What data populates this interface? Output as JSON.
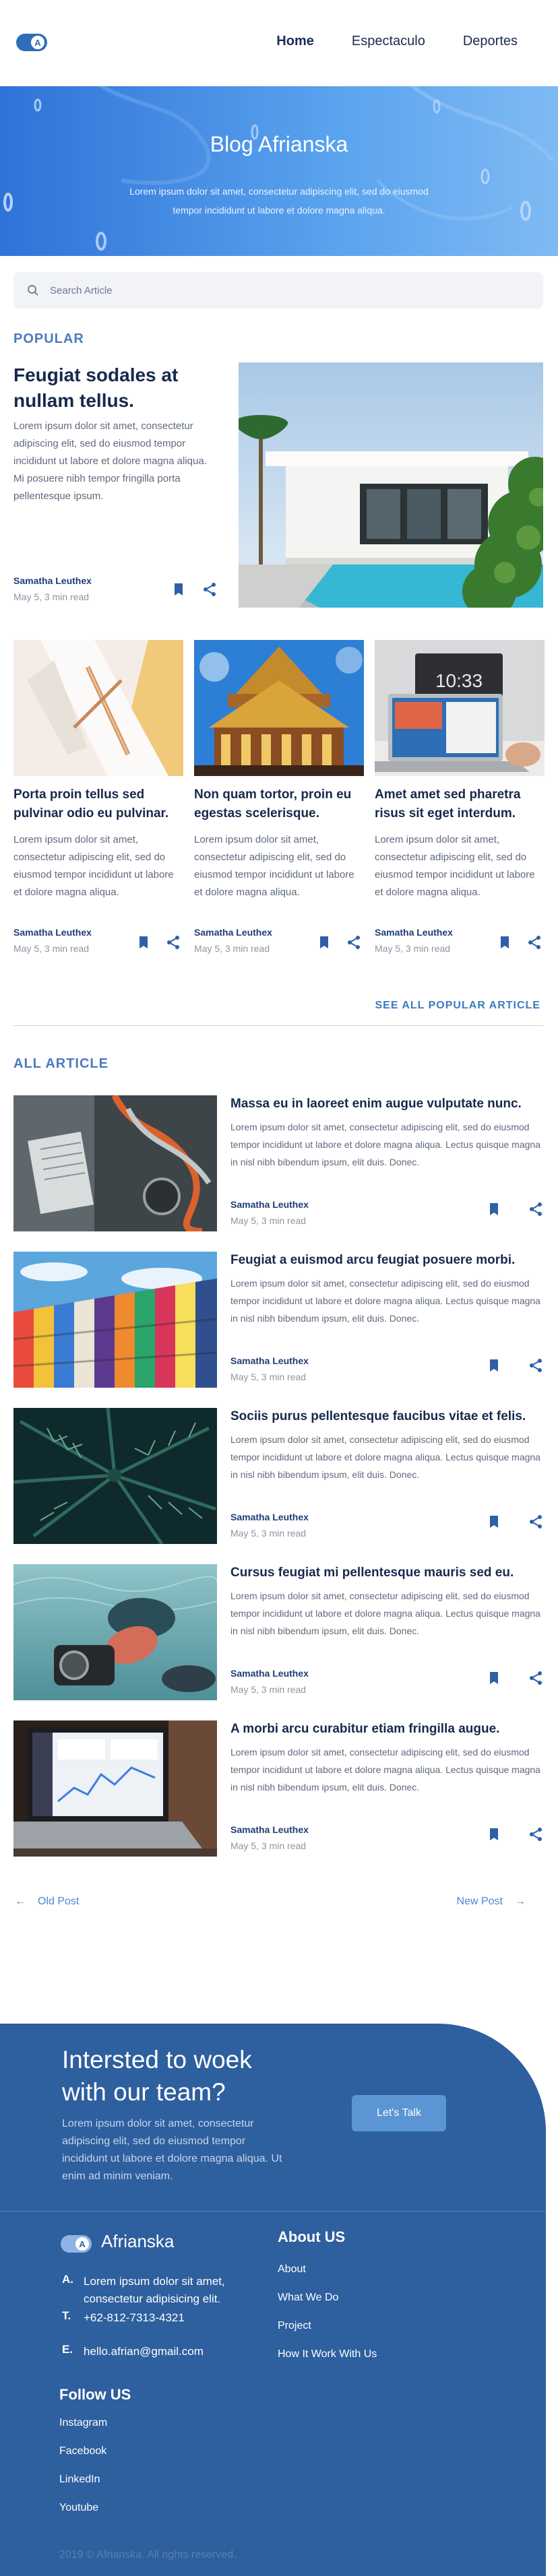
{
  "nav": {
    "items": [
      "Home",
      "Espectaculo",
      "Deportes"
    ],
    "active": "Home"
  },
  "hero": {
    "title": "Blog Afrianska",
    "subtitle": "Lorem ipsum dolor sit amet, consectetur adipiscing elit, sed do eiusmod tempor incididunt ut labore et dolore magna aliqua."
  },
  "search": {
    "placeholder": "Search Article"
  },
  "popular": {
    "heading": "POPULAR",
    "featured": {
      "title": "Feugiat sodales at nullam tellus.",
      "body": "Lorem ipsum dolor sit amet, consectetur adipiscing elit, sed do eiusmod tempor incididunt ut labore et dolore magna aliqua. Mi posuere nibh tempor fringilla porta pellentesque ipsum.",
      "author": "Samatha Leuthex",
      "meta": "May 5, 3 min read"
    },
    "cards": [
      {
        "title": "Porta proin tellus sed pulvinar odio eu pulvinar.",
        "body": "Lorem ipsum dolor sit amet, consectetur adipiscing elit, sed do eiusmod tempor incididunt ut labore et dolore magna aliqua.",
        "author": "Samatha Leuthex",
        "meta": "May 5, 3 min read"
      },
      {
        "title": "Non quam tortor, proin eu egestas scelerisque.",
        "body": "Lorem ipsum dolor sit amet, consectetur adipiscing elit, sed do eiusmod tempor incididunt ut labore et dolore magna aliqua.",
        "author": "Samatha Leuthex",
        "meta": "May 5, 3 min read"
      },
      {
        "title": "Amet amet sed pharetra risus sit eget interdum.",
        "body": "Lorem ipsum dolor sit amet, consectetur adipiscing elit, sed do eiusmod tempor incididunt ut labore et dolore magna aliqua.",
        "author": "Samatha Leuthex",
        "meta": "May 5, 3 min read"
      }
    ],
    "see_all": "SEE ALL POPULAR ARTICLE"
  },
  "all": {
    "heading": "ALL ARTICLE",
    "articles": [
      {
        "title": "Massa eu in laoreet enim augue vulputate nunc.",
        "body": "Lorem ipsum dolor sit amet, consectetur adipiscing elit, sed do eiusmod tempor incididunt ut labore et dolore magna aliqua. Lectus quisque magna in nisl nibh bibendum ipsum, elit duis. Donec.",
        "author": "Samatha Leuthex",
        "meta": "May 5, 3 min read"
      },
      {
        "title": "Feugiat a euismod arcu feugiat posuere morbi.",
        "body": "Lorem ipsum dolor sit amet, consectetur adipiscing elit, sed do eiusmod tempor incididunt ut labore et dolore magna aliqua. Lectus quisque magna in nisl nibh bibendum ipsum, elit duis. Donec.",
        "author": "Samatha Leuthex",
        "meta": "May 5, 3 min read"
      },
      {
        "title": "Sociis purus pellentesque faucibus vitae et felis.",
        "body": "Lorem ipsum dolor sit amet, consectetur adipiscing elit, sed do eiusmod tempor incididunt ut labore et dolore magna aliqua. Lectus quisque magna in nisl nibh bibendum ipsum, elit duis. Donec.",
        "author": "Samatha Leuthex",
        "meta": "May 5, 3 min read"
      },
      {
        "title": "Cursus feugiat mi pellentesque mauris sed eu.",
        "body": "Lorem ipsum dolor sit amet, consectetur adipiscing elit, sed do eiusmod tempor incididunt ut labore et dolore magna aliqua. Lectus quisque magna in nisl nibh bibendum ipsum, elit duis. Donec.",
        "author": "Samatha Leuthex",
        "meta": "May 5, 3 min read"
      },
      {
        "title": "A morbi arcu curabitur etiam fringilla augue.",
        "body": "Lorem ipsum dolor sit amet, consectetur adipiscing elit, sed do eiusmod tempor incididunt ut labore et dolore magna aliqua. Lectus quisque magna in nisl nibh bibendum ipsum, elit duis. Donec.",
        "author": "Samatha Leuthex",
        "meta": "May 5, 3 min read"
      }
    ]
  },
  "pager": {
    "old": "Old Post",
    "new": "New Post"
  },
  "footer": {
    "cta_title": "Intersted to woek with our team?",
    "cta_body": "Lorem ipsum dolor sit amet, consectetur adipiscing elit, sed do eiusmod tempor incididunt ut labore et dolore magna aliqua. Ut enim ad minim veniam.",
    "cta_button": "Let's Talk",
    "brand": "Afrianska",
    "contact": [
      {
        "key": "A.",
        "value": "Lorem ipsum dolor sit amet, consectetur adipisicing elit."
      },
      {
        "key": "T.",
        "value": "+62-812-7313-4321"
      },
      {
        "key": "E.",
        "value": "hello.afrian@gmail.com"
      }
    ],
    "about_heading": "About US",
    "about_links": [
      "About",
      "What We Do",
      "Project",
      "How It Work With Us"
    ],
    "follow_heading": "Follow US",
    "social": [
      "Instagram",
      "Facebook",
      "LinkedIn",
      "Youtube"
    ],
    "copyright": "2019 © Afrianska. All rights reserved."
  },
  "colors": {
    "primary": "#2e5f9e",
    "accent": "#3d7ac4",
    "heading": "#17294d",
    "hero_start": "#2f73d8",
    "hero_end": "#7fbaf4"
  }
}
